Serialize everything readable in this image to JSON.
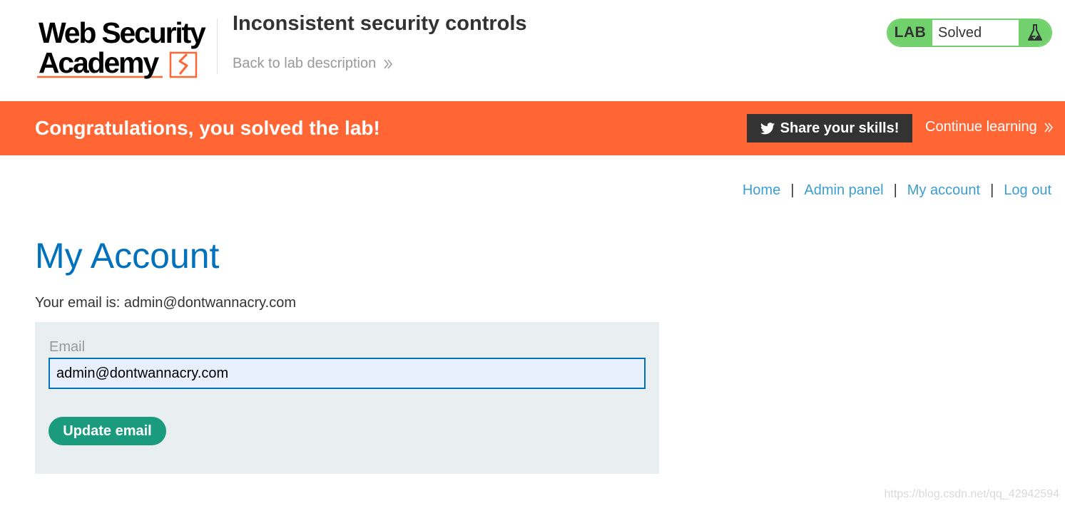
{
  "header": {
    "logo": {
      "line1": "Web Security",
      "line2": "Academy"
    },
    "lab_title": "Inconsistent security controls",
    "back_link": "Back to lab description",
    "lab_status": {
      "label": "LAB",
      "state": "Solved",
      "icon": "flask-icon"
    }
  },
  "banner": {
    "message": "Congratulations, you solved the lab!",
    "share_button": "Share your skills!",
    "share_icon": "twitter-icon",
    "continue_link": "Continue learning"
  },
  "nav": {
    "items": [
      {
        "label": "Home"
      },
      {
        "label": "Admin panel"
      },
      {
        "label": "My account"
      },
      {
        "label": "Log out"
      }
    ],
    "separator": "|"
  },
  "main": {
    "title": "My Account",
    "email_line": "Your email is: admin@dontwannacry.com",
    "form": {
      "email_label": "Email",
      "email_value": "admin@dontwannacry.com",
      "submit_label": "Update email"
    }
  },
  "watermark": "https://blog.csdn.net/qq_42942594",
  "colors": {
    "brand_orange": "#ff6633",
    "lab_green": "#70d16d",
    "title_blue": "#0071bc",
    "link_blue": "#3c9dd1",
    "button_green": "#1a9b7e",
    "panel_bg": "#e9eef1",
    "dark_button": "#333333"
  }
}
